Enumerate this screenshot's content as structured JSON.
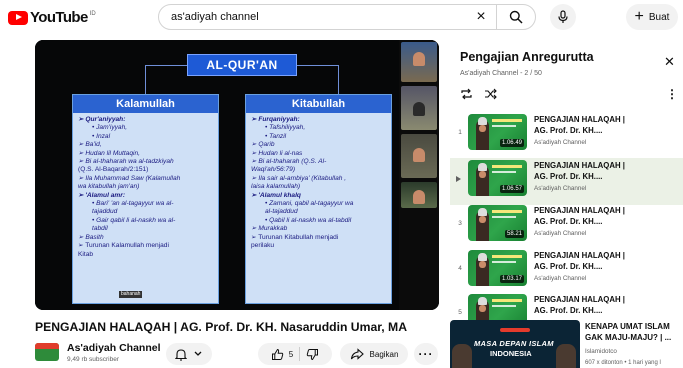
{
  "header": {
    "logo_text": "YouTube",
    "region": "ID",
    "search_value": "as'adiyah channel",
    "create_label": "Buat"
  },
  "slide": {
    "title": "AL-QUR'AN",
    "left_head": "Kalamullah",
    "right_head": "Kitabullah",
    "left_lines": [
      {
        "t": "➢  Qur'aniyyah:",
        "c": "l b"
      },
      {
        "t": "•  Jam'iyyah,",
        "c": "l i1"
      },
      {
        "t": "•  Inzal",
        "c": "l i1"
      },
      {
        "t": "➢  Ba'id,",
        "c": "l"
      },
      {
        "t": "➢  Hudan lil Muttaqin,",
        "c": "l"
      },
      {
        "t": "➢  Bi al-thaharah wa al-tadzkiyah",
        "c": "l"
      },
      {
        "t": "    (Q.S. Al-Baqarah/2:151)",
        "c": "l n"
      },
      {
        "t": "➢  Ila Muhammad Saw (Kalamullah",
        "c": "l"
      },
      {
        "t": "    wa kitabullah jam'an)",
        "c": "l"
      },
      {
        "t": "➢  'Alamul amr:",
        "c": "l b"
      },
      {
        "t": "•  Bari' 'an al-tagayyur wa al-",
        "c": "l i1"
      },
      {
        "t": "   tajaddud",
        "c": "l i1"
      },
      {
        "t": "•  Gair qabil li al-naskh wa al-",
        "c": "l i1"
      },
      {
        "t": "   tabdil",
        "c": "l i1"
      },
      {
        "t": "➢  Basith",
        "c": "l"
      },
      {
        "t": "➢  Turunan Kalamullah menjadi",
        "c": "l n"
      },
      {
        "t": "    Kitab",
        "c": "l n"
      }
    ],
    "right_lines": [
      {
        "t": "➢  Furqaniyyah:",
        "c": "l b"
      },
      {
        "t": "•  Tafshiliyyah,",
        "c": "l i1"
      },
      {
        "t": "•  Tanzil",
        "c": "l i1"
      },
      {
        "t": "➢  Qarib",
        "c": "l"
      },
      {
        "t": "➢  Hudan li al-nas",
        "c": "l"
      },
      {
        "t": "➢  Bi al-thaharah (Q.S. Al-",
        "c": "l"
      },
      {
        "t": "    Waqi'ah/56:79)",
        "c": "l"
      },
      {
        "t": "➢  Ila sair al-ambiya' (Kitabullah ,",
        "c": "l"
      },
      {
        "t": "    laisa kalamullah)",
        "c": "l"
      },
      {
        "t": "",
        "c": "l"
      },
      {
        "t": "➢  'Alamul khalq",
        "c": "l b"
      },
      {
        "t": "•  Zamani, qabil al-tagayyur wa",
        "c": "l i1"
      },
      {
        "t": "   al-tajaddud",
        "c": "l i1"
      },
      {
        "t": "•  Qabil li al-naskh wa al-tabdil",
        "c": "l i1"
      },
      {
        "t": "",
        "c": "l"
      },
      {
        "t": "➢  Murakkab",
        "c": "l"
      },
      {
        "t": "➢  Turunan Kitabullah menjadi",
        "c": "l n"
      },
      {
        "t": "    perilaku",
        "c": "l n"
      }
    ],
    "watermark": "bahanah"
  },
  "video": {
    "title": "PENGAJIAN HALAQAH | AG. Prof. Dr. KH. Nasaruddin Umar, MA",
    "channel": "As'adiyah Channel",
    "subscribers": "9,49 rb subscriber",
    "like_count": "5",
    "share_label": "Bagikan"
  },
  "playlist": {
    "title": "Pengajian Anregurutta",
    "subtitle": "As'adiyah Channel - 2 / 50",
    "items": [
      {
        "index": "1",
        "title1": "PENGAJIAN HALAQAH |",
        "title2": "AG. Prof. Dr. KH....",
        "channel": "As'adiyah Channel",
        "duration": "1.06.49"
      },
      {
        "index": "",
        "title1": "PENGAJIAN HALAQAH |",
        "title2": "AG. Prof. Dr. KH....",
        "channel": "As'adiyah Channel",
        "duration": "1.06.57"
      },
      {
        "index": "3",
        "title1": "PENGAJIAN HALAQAH |",
        "title2": "AG. Prof. Dr. KH....",
        "channel": "As'adiyah Channel",
        "duration": "58.21"
      },
      {
        "index": "4",
        "title1": "PENGAJIAN HALAQAH |",
        "title2": "AG. Prof. Dr. KH....",
        "channel": "As'adiyah Channel",
        "duration": "1.03.17"
      },
      {
        "index": "5",
        "title1": "PENGAJIAN HALAQAH |",
        "title2": "AG. Prof. Dr. KH....",
        "channel": "",
        "duration": ""
      }
    ]
  },
  "recommendation": {
    "thumb_line1": "MASA DEPAN ISLAM",
    "thumb_line2": "INDONESIA",
    "title": "KENAPA UMAT ISLAM GAK MAJU-MAJU? | ...",
    "channel": "Islamidotco",
    "meta": "607 x ditonton • 1 hari yang l"
  },
  "icons": {
    "logo": "youtube-logo-icon",
    "clear": "close-icon",
    "search": "search-icon",
    "mic": "mic-icon",
    "create": "plus-icon",
    "like": "thumbs-up-icon",
    "dislike": "thumbs-down-icon",
    "share": "share-icon",
    "notify": "bell-icon"
  },
  "colors": {
    "brand_red": "#ff0000",
    "slide_blue": "#2b63d0",
    "slide_box": "#cfe0f6",
    "active_row": "#ebf1e6"
  }
}
